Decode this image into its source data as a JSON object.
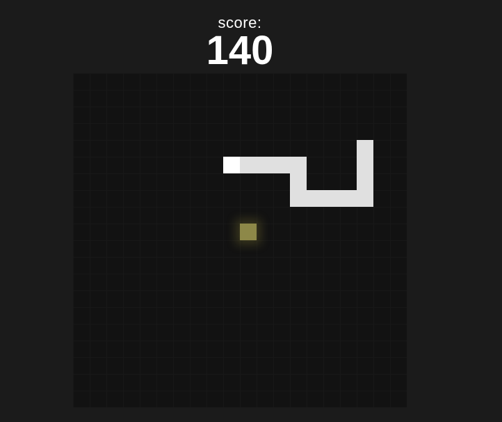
{
  "score": {
    "label": "score:",
    "value": "140"
  },
  "board": {
    "columns": 20,
    "rows": 20
  },
  "snake": {
    "head_color": "#ffffff",
    "body_color": "#e0e0e0",
    "segments": [
      {
        "col": 9,
        "row": 5,
        "part": "head"
      },
      {
        "col": 10,
        "row": 5,
        "part": "body"
      },
      {
        "col": 11,
        "row": 5,
        "part": "body"
      },
      {
        "col": 12,
        "row": 5,
        "part": "body"
      },
      {
        "col": 13,
        "row": 5,
        "part": "body"
      },
      {
        "col": 13,
        "row": 6,
        "part": "body"
      },
      {
        "col": 13,
        "row": 7,
        "part": "body"
      },
      {
        "col": 14,
        "row": 7,
        "part": "body"
      },
      {
        "col": 15,
        "row": 7,
        "part": "body"
      },
      {
        "col": 16,
        "row": 7,
        "part": "body"
      },
      {
        "col": 17,
        "row": 7,
        "part": "body"
      },
      {
        "col": 17,
        "row": 6,
        "part": "body"
      },
      {
        "col": 17,
        "row": 5,
        "part": "body"
      },
      {
        "col": 17,
        "row": 4,
        "part": "body"
      }
    ]
  },
  "food": {
    "col": 10,
    "row": 9,
    "color": "#8d8848"
  }
}
